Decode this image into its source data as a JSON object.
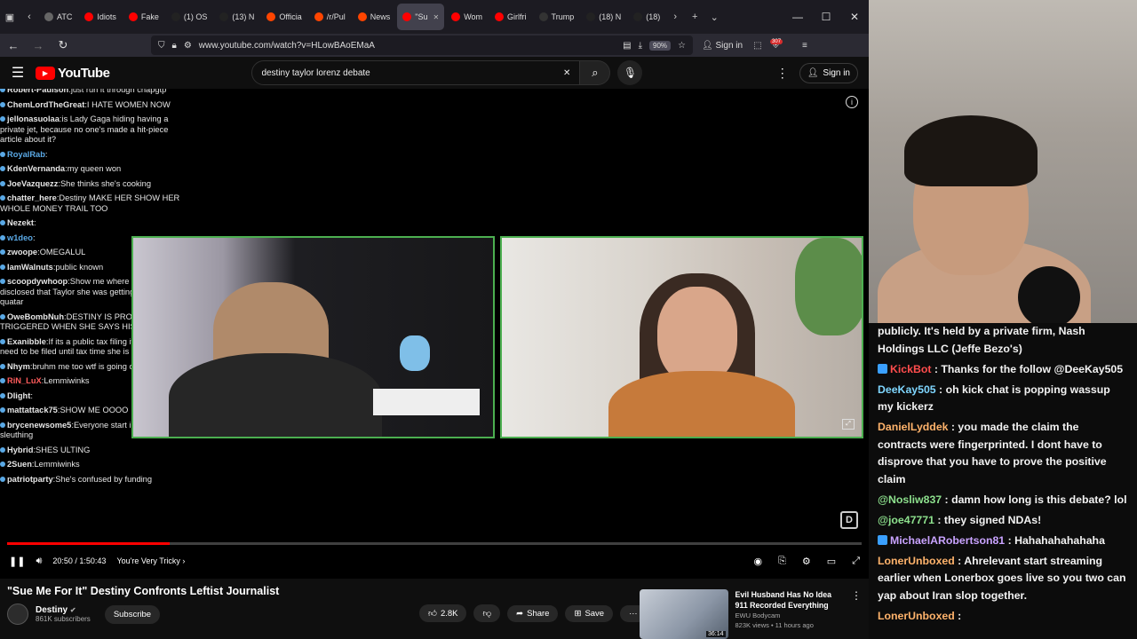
{
  "browser": {
    "tabs": [
      {
        "label": "ATC",
        "fav_color": "#666"
      },
      {
        "label": "Idiots",
        "fav_color": "#ff0000"
      },
      {
        "label": "Fake",
        "fav_color": "#ff0000"
      },
      {
        "label": "(1) OS",
        "fav_color": "#222"
      },
      {
        "label": "(13) N",
        "fav_color": "#222"
      },
      {
        "label": "Officia",
        "fav_color": "#ff4500"
      },
      {
        "label": "/r/Pul",
        "fav_color": "#ff4500"
      },
      {
        "label": "News",
        "fav_color": "#ff4500"
      },
      {
        "label": "\"Su",
        "fav_color": "#ff0000",
        "active": true
      },
      {
        "label": "Wom",
        "fav_color": "#ff0000"
      },
      {
        "label": "Girlfri",
        "fav_color": "#ff0000"
      },
      {
        "label": "Trump",
        "fav_color": "#333"
      },
      {
        "label": "(18) N",
        "fav_color": "#222"
      },
      {
        "label": "(18)",
        "fav_color": "#222"
      }
    ],
    "url": "www.youtube.com/watch?v=HLowBAoEMaA",
    "zoom": "90%",
    "signin_label": "Sign in",
    "ext_badge": "307"
  },
  "youtube": {
    "logo_text": "YouTube",
    "search_query": "destiny taylor lorenz debate",
    "signin_label": "Sign in"
  },
  "overlay_chat": [
    {
      "name": "Robert-Paulson",
      "text": "just run it through chapgtp",
      "color": "#e6e6e6"
    },
    {
      "name": "ChemLordTheGreat",
      "text": "I HATE WOMEN NOW",
      "color": "#e6e6e6"
    },
    {
      "name": "jellonasuolaa",
      "text": "is Lady Gaga hiding having a private jet, because no one's made a hit-piece article about it?",
      "color": "#e6e6e6"
    },
    {
      "name": "RoyalRab",
      "text": "",
      "color": "#5aa9e6"
    },
    {
      "name": "KdenVernanda",
      "text": "my queen won",
      "color": "#e6e6e6"
    },
    {
      "name": "JoeVazquezz",
      "text": "She thinks she's cooking",
      "color": "#e6e6e6"
    },
    {
      "name": "chatter_here",
      "text": "Destiny MAKE HER SHOW HER WHOLE MONEY TRAIL TOO",
      "color": "#e6e6e6"
    },
    {
      "name": "Nezekt",
      "text": "",
      "color": "#e6e6e6"
    },
    {
      "name": "w1deo",
      "text": "",
      "color": "#5aa9e6"
    },
    {
      "name": "zwoope",
      "text": "OMEGALUL",
      "color": "#e6e6e6"
    },
    {
      "name": "IamWalnuts",
      "text": "public known",
      "color": "#e6e6e6"
    },
    {
      "name": "scoopdywhoop",
      "text": "Show me where it was disclosed that Taylor she was getting money from quatar",
      "color": "#e6e6e6"
    },
    {
      "name": "OweBombNuh",
      "text": "DESTINY IS PROBABLY SO TRIGGERED WHEN SHE SAYS HIS NAME",
      "color": "#e6e6e6"
    },
    {
      "name": "Exanibble",
      "text": "If its a public tax filing it wouldnt even need to be filed until tax time she is being slippery",
      "color": "#e6e6e6"
    },
    {
      "name": "Nhym",
      "text": "bruhm me too wtf is going on",
      "color": "#e6e6e6"
    },
    {
      "name": "RiN_LuX",
      "text": "Lemmiwinks",
      "color": "#ff5c5c"
    },
    {
      "name": "Dlight",
      "text": "",
      "color": "#e6e6e6"
    },
    {
      "name": "mattattack75",
      "text": "SHOW ME OOOO",
      "color": "#e6e6e6"
    },
    {
      "name": "brycenewsome5",
      "text": "Everyone start internet sleuthing",
      "color": "#e6e6e6"
    },
    {
      "name": "Hybrid",
      "text": "SHES ULTING",
      "color": "#e6e6e6"
    },
    {
      "name": "2Suen",
      "text": "Lemmiwinks",
      "color": "#e6e6e6"
    },
    {
      "name": "patriotparty",
      "text": "She's confused by funding",
      "color": "#e6e6e6"
    }
  ],
  "player": {
    "time": "20:50 / 1:50:43",
    "chapter": "You're Very Tricky",
    "progress_fraction": 0.19
  },
  "video": {
    "title": "\"Sue Me For It\" Destiny Confronts Leftist Journalist",
    "channel": "Destiny",
    "subscribers": "861K subscribers",
    "subscribe_label": "Subscribe",
    "likes": "2.8K",
    "share_label": "Share",
    "save_label": "Save"
  },
  "recommended": {
    "title": "Evil Husband Has No Idea 911 Recorded Everything",
    "channel": "EWU Bodycam",
    "meta": "823K views • 11 hours ago",
    "duration": "36:14"
  },
  "stream_chat": [
    {
      "user": "",
      "text": "publicly. It's held by a private firm, Nash Holdings LLC (Jeffe Bezo's)",
      "color": "#f2f2f2"
    },
    {
      "user": "KickBot",
      "text": " : Thanks for the follow @DeeKay505",
      "color": "#ff4d4d",
      "badge": "#3aa0ff"
    },
    {
      "user": "DeeKay505",
      "text": " : oh kick chat is popping wassup my kickerz",
      "color": "#7fd6ff"
    },
    {
      "user": "DanielLyddek",
      "text": " : you made the claim the contracts were fingerprinted. I dont have to disprove that you have to prove the positive claim",
      "color": "#ffb36b"
    },
    {
      "user": "@Nosliw837",
      "text": " : damn how long is this debate? lol",
      "color": "#8de08d"
    },
    {
      "user": "@joe47771",
      "text": " : they signed NDAs!",
      "color": "#8de08d"
    },
    {
      "user": "MichaelARobertson81",
      "text": " : Hahahahahahaha",
      "color": "#c9a3ff",
      "badge": "#3aa0ff"
    },
    {
      "user": "LonerUnboxed",
      "text": " : Ahrelevant start streaming earlier when Lonerbox goes live so you two can yap about Iran slop together.",
      "color": "#ffb36b"
    },
    {
      "user": "LonerUnboxed",
      "text": " : ",
      "color": "#ffb36b"
    }
  ]
}
